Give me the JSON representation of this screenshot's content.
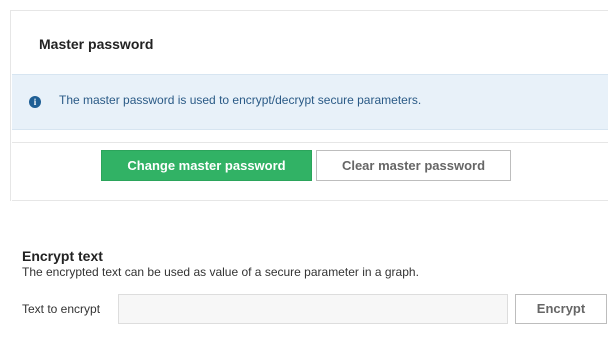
{
  "master_password": {
    "title": "Master password",
    "info": {
      "icon": "info-circle-icon",
      "text": "The master password is used to encrypt/decrypt secure parameters."
    },
    "buttons": {
      "change_label": "Change master password",
      "clear_label": "Clear master password"
    }
  },
  "encrypt_text": {
    "heading": "Encrypt text",
    "description": "The encrypted text can be used as value of a secure parameter in a graph.",
    "field_label": "Text to encrypt",
    "input_value": "",
    "button_label": "Encrypt"
  },
  "colors": {
    "primary_button": "#31b265",
    "info_background": "#e8f1f9",
    "info_icon": "#1f5f95"
  }
}
